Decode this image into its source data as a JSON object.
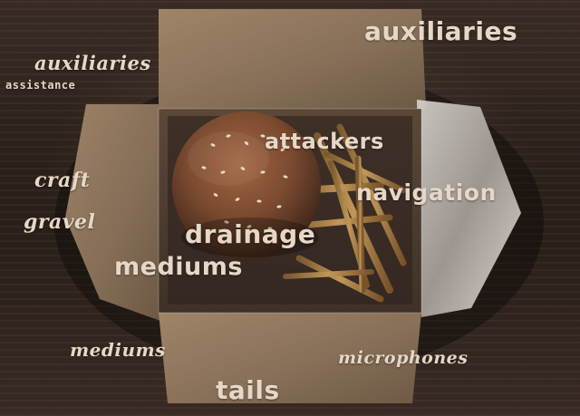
{
  "image": {
    "subject": "Open kraft paper takeout box with a sesame seed burger bun and french fries on dark wood table",
    "words": [
      {
        "text": "auxiliaries"
      },
      {
        "text": "auxiliaries"
      },
      {
        "text": "assistance"
      },
      {
        "text": "attackers"
      },
      {
        "text": "craft"
      },
      {
        "text": "navigation"
      },
      {
        "text": "gravel"
      },
      {
        "text": "drainage"
      },
      {
        "text": "mediums"
      },
      {
        "text": "mediums"
      },
      {
        "text": "microphones"
      },
      {
        "text": "tails"
      }
    ],
    "colors": {
      "table_dark": "#2b211b",
      "box_kraft": "#8a725a",
      "bun": "#7b4a2f",
      "fries": "#b98b4b",
      "text": "#e6d7c7"
    }
  }
}
